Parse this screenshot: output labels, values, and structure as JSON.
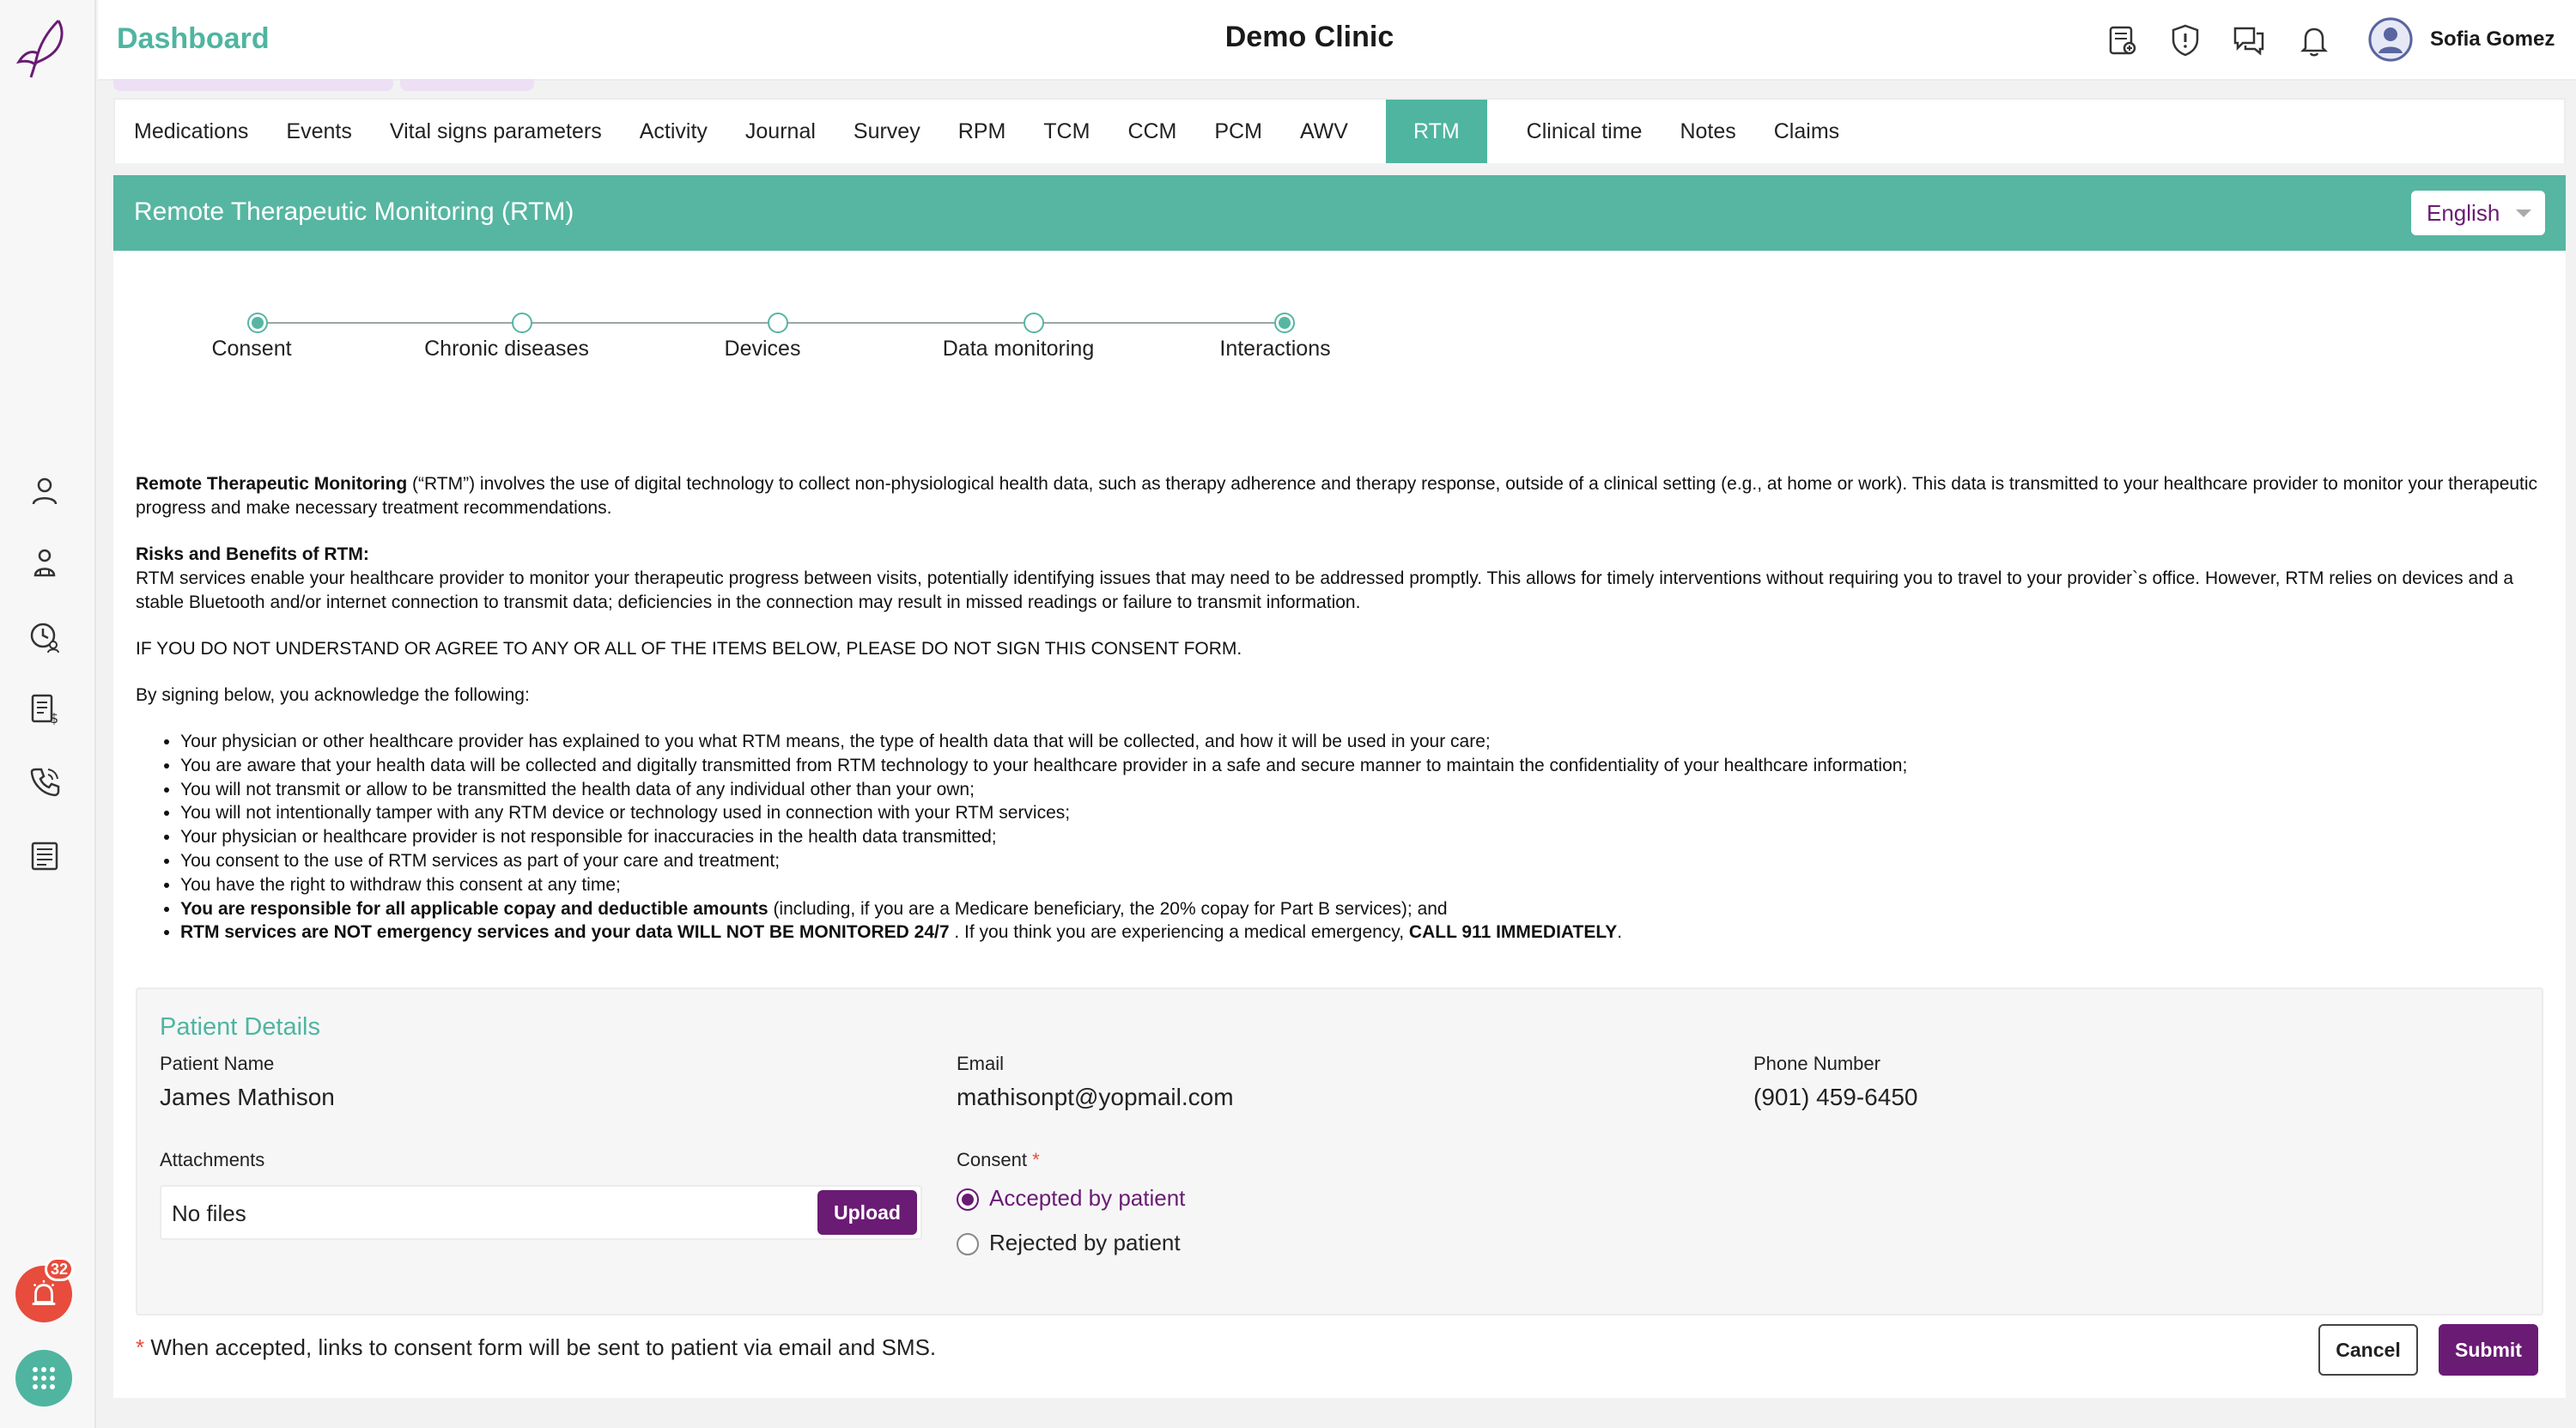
{
  "header": {
    "dashboard_label": "Dashboard",
    "clinic_name": "Demo Clinic",
    "user_name": "Sofia Gomez"
  },
  "icons": {
    "logo": "feather-logo-icon",
    "header": [
      "medical-chart-icon",
      "shield-alert-icon",
      "chat-bubbles-icon",
      "bell-icon",
      "user-avatar-icon"
    ],
    "sidebar": [
      "user-icon",
      "users-group-icon",
      "clock-user-icon",
      "billing-icon",
      "phone-icon",
      "list-icon",
      "alarm-icon",
      "apps-grid-icon"
    ]
  },
  "sidebar": {
    "alert_count": "32"
  },
  "tabs": [
    {
      "label": "Medications"
    },
    {
      "label": "Events"
    },
    {
      "label": "Vital signs parameters"
    },
    {
      "label": "Activity"
    },
    {
      "label": "Journal"
    },
    {
      "label": "Survey"
    },
    {
      "label": "RPM"
    },
    {
      "label": "TCM"
    },
    {
      "label": "CCM"
    },
    {
      "label": "PCM"
    },
    {
      "label": "AWV"
    },
    {
      "label": "RTM",
      "active": true
    },
    {
      "label": "Clinical time"
    },
    {
      "label": "Notes"
    },
    {
      "label": "Claims"
    }
  ],
  "banner": {
    "title": "Remote Therapeutic Monitoring (RTM)",
    "language": "English"
  },
  "stepper": [
    {
      "label": "Consent",
      "state": "filled"
    },
    {
      "label": "Chronic diseases",
      "state": "empty"
    },
    {
      "label": "Devices",
      "state": "empty"
    },
    {
      "label": "Data monitoring",
      "state": "empty"
    },
    {
      "label": "Interactions",
      "state": "filled"
    }
  ],
  "consent": {
    "intro_bold": "Remote Therapeutic Monitoring",
    "intro_rest": " (“RTM”) involves the use of digital technology to collect non-physiological health data, such as therapy adherence and therapy response, outside of a clinical setting (e.g., at home or work). This data is transmitted to your healthcare provider to monitor your therapeutic progress and make necessary treatment recommendations.",
    "risks_heading": "Risks and Benefits of RTM:",
    "risks_text": "RTM services enable your healthcare provider to monitor your therapeutic progress between visits, potentially identifying issues that may need to be addressed promptly. This allows for timely interventions without requiring you to travel to your provider`s office. However, RTM relies on devices and a stable Bluetooth and/or internet connection to transmit data; deficiencies in the connection may result in missed readings or failure to transmit information.",
    "warning": "IF YOU DO NOT UNDERSTAND OR AGREE TO ANY OR ALL OF THE ITEMS BELOW, PLEASE DO NOT SIGN THIS CONSENT FORM.",
    "acknowledge": "By signing below, you acknowledge the following:",
    "items": [
      "Your physician or other healthcare provider has explained to you what RTM means, the type of health data that will be collected, and how it will be used in your care;",
      "You are aware that your health data will be collected and digitally transmitted from RTM technology to your healthcare provider in a safe and secure manner to maintain the confidentiality of your healthcare information;",
      "You will not transmit or allow to be transmitted the health data of any individual other than your own;",
      "You will not intentionally tamper with any RTM device or technology used in connection with your RTM services;",
      "Your physician or healthcare provider is not responsible for inaccuracies in the health data transmitted;",
      "You consent to the use of RTM services as part of your care and treatment;",
      "You have the right to withdraw this consent at any time;"
    ],
    "copay_bold": "You are responsible for all applicable copay and deductible amounts",
    "copay_rest": " (including, if you are a Medicare beneficiary, the 20% copay for Part B services); and",
    "emergency_bold": "RTM services are NOT emergency services and your data WILL NOT BE MONITORED 24/7",
    "emergency_mid": " . If you think you are experiencing a medical emergency, ",
    "emergency_call": "CALL 911 IMMEDIATELY",
    "emergency_end": "."
  },
  "patient_details": {
    "title": "Patient Details",
    "name_label": "Patient Name",
    "name_value": "James Mathison",
    "email_label": "Email",
    "email_value": "mathisonpt@yopmail.com",
    "phone_label": "Phone Number",
    "phone_value": "(901) 459-6450",
    "attachments_label": "Attachments",
    "attachments_value": "No files",
    "upload_label": "Upload",
    "consent_label": "Consent",
    "consent_required_mark": "*",
    "options": [
      {
        "label": "Accepted by patient",
        "selected": true
      },
      {
        "label": "Rejected by patient",
        "selected": false
      }
    ]
  },
  "footer": {
    "note_mark": "*",
    "note": " When accepted, links to consent form will be sent to patient via email and SMS.",
    "cancel_label": "Cancel",
    "submit_label": "Submit"
  },
  "colors": {
    "accent": "#56b6a2",
    "primary": "#6a1b74",
    "alert": "#e74c3c"
  }
}
